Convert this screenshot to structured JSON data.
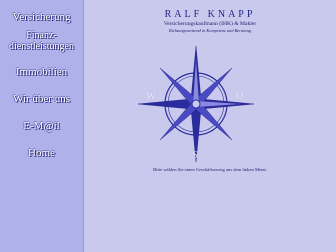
{
  "nav": {
    "items": [
      {
        "label": "Versicherung"
      },
      {
        "label_line1": "Finanz-",
        "label_line2": "dienstleistungen"
      },
      {
        "label": "Immobilien"
      },
      {
        "label": "Wir über uns"
      },
      {
        "label": "E-M@il"
      },
      {
        "label": "Home"
      }
    ]
  },
  "header": {
    "brand": "RALF KNAPP",
    "subtitle": "Versicherungskaufmann (IHK) & Makler",
    "claim": "Richtungsweisend in Kompetenz und Beratung"
  },
  "compass": {
    "west": "W",
    "east": "O",
    "south": "S"
  },
  "main": {
    "hint": "Bitte wählen Sie einen Geschäftszweig aus dem linken Menü."
  },
  "colors": {
    "background": "#c9c9ee",
    "sidebar": "#aeb1ea",
    "compass": "#2b2ba0"
  }
}
